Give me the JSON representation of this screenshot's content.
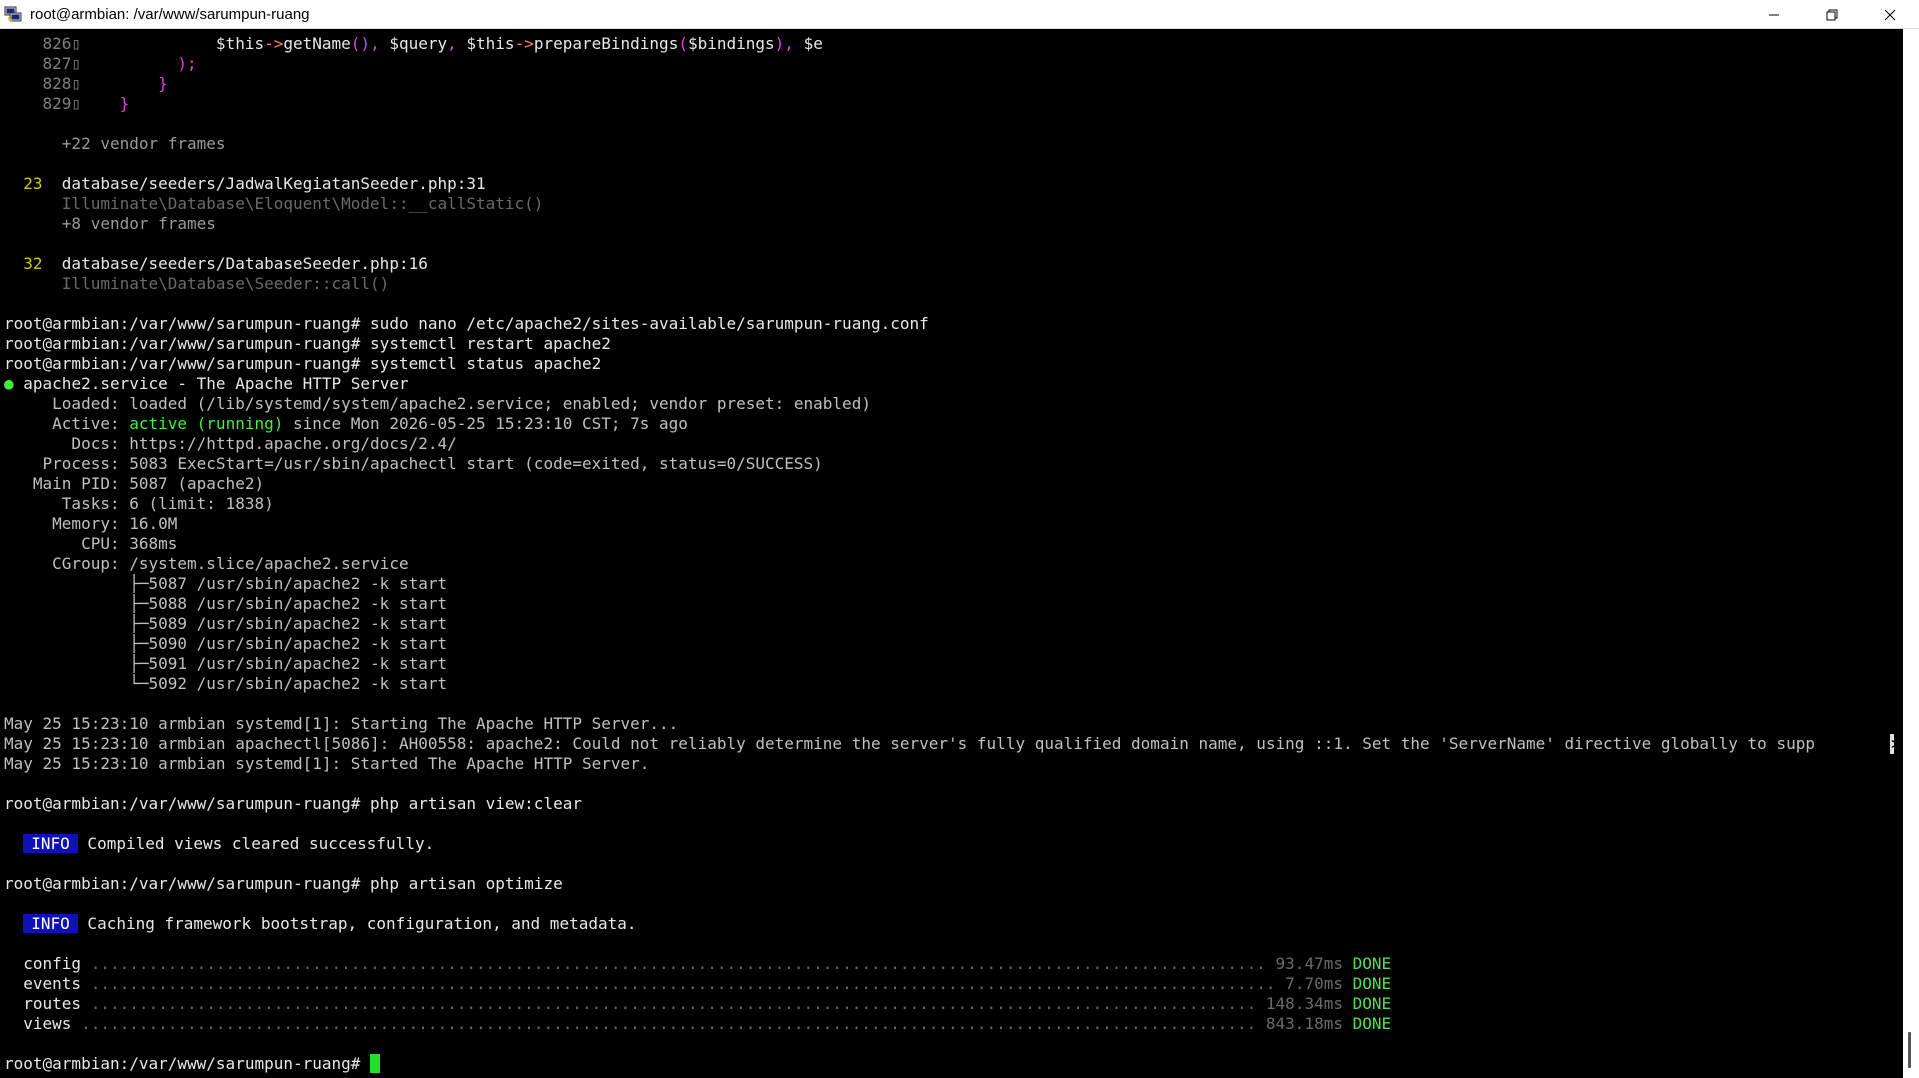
{
  "window": {
    "title": "root@armbian: /var/www/sarumpun-ruang"
  },
  "code": {
    "l826_num": "826▯",
    "l826_a": "$this",
    "l826_b": "->",
    "l826_c": "getName",
    "l826_d": "(), ",
    "l826_e": "$query",
    "l826_f": ", ",
    "l826_g": "$this",
    "l826_h": "->",
    "l826_i": "prepareBindings",
    "l826_j": "(",
    "l826_k": "$bindings",
    "l826_l": "), ",
    "l826_m": "$e",
    "l827_num": "827▯",
    "l827_text": ");",
    "l828_num": "828▯",
    "l828_text": "}",
    "l829_num": "829▯",
    "l829_text": "}",
    "vendor22": "+22 vendor frames",
    "f23_num": "23",
    "f23_file": "database/seeders/JadwalKegiatanSeeder.php:31",
    "f23_call": "Illuminate\\Database\\Eloquent\\Model::__callStatic()",
    "vendor8": "+8 vendor frames",
    "f32_num": "32",
    "f32_file": "database/seeders/DatabaseSeeder.php:16",
    "f32_call": "Illuminate\\Database\\Seeder::call()"
  },
  "prompt": "root@armbian:/var/www/sarumpun-ruang# ",
  "commands": {
    "nano": "sudo nano /etc/apache2/sites-available/sarumpun-ruang.conf",
    "restart": "systemctl restart apache2",
    "status": "systemctl status apache2",
    "view_clear": "php artisan view:clear",
    "optimize": "php artisan optimize"
  },
  "status": {
    "dot": "●",
    "unit": " apache2.service - The Apache HTTP Server",
    "loaded": "     Loaded: loaded (/lib/systemd/system/apache2.service; enabled; vendor preset: enabled)",
    "active_label": "     Active: ",
    "active_state": "active (running)",
    "active_rest": " since Mon 2026-05-25 15:23:10 CST; 7s ago",
    "docs": "       Docs: https://httpd.apache.org/docs/2.4/",
    "process": "    Process: 5083 ExecStart=/usr/sbin/apachectl start (code=exited, status=0/SUCCESS)",
    "mainpid": "   Main PID: 5087 (apache2)",
    "tasks": "      Tasks: 6 (limit: 1838)",
    "memory": "     Memory: 16.0M",
    "cpu": "        CPU: 368ms",
    "cgroup": "     CGroup: /system.slice/apache2.service",
    "procs": [
      "             ├─5087 /usr/sbin/apache2 -k start",
      "             ├─5088 /usr/sbin/apache2 -k start",
      "             ├─5089 /usr/sbin/apache2 -k start",
      "             ├─5090 /usr/sbin/apache2 -k start",
      "             ├─5091 /usr/sbin/apache2 -k start",
      "             └─5092 /usr/sbin/apache2 -k start"
    ]
  },
  "journal": [
    "May 25 15:23:10 armbian systemd[1]: Starting The Apache HTTP Server...",
    "May 25 15:23:10 armbian apachectl[5086]: AH00558: apache2: Could not reliably determine the server's fully qualified domain name, using ::1. Set the 'ServerName' directive globally to supp",
    "May 25 15:23:10 armbian systemd[1]: Started The Apache HTTP Server."
  ],
  "truncation_marker": ">",
  "info": {
    "badge": "INFO",
    "views_cleared": " Compiled views cleared successfully.",
    "caching": " Caching framework bootstrap, configuration, and metadata."
  },
  "optimize_tasks": [
    {
      "name": "  config ",
      "dots": "..........................................................................................................................",
      "time": " 93.47ms",
      "status": " DONE"
    },
    {
      "name": "  events ",
      "dots": "...........................................................................................................................",
      "time": " 7.70ms",
      "status": " DONE"
    },
    {
      "name": "  routes ",
      "dots": ".........................................................................................................................",
      "time": " 148.34ms",
      "status": " DONE"
    },
    {
      "name": "  views ",
      "dots": "..........................................................................................................................",
      "time": " 843.18ms",
      "status": " DONE"
    }
  ]
}
